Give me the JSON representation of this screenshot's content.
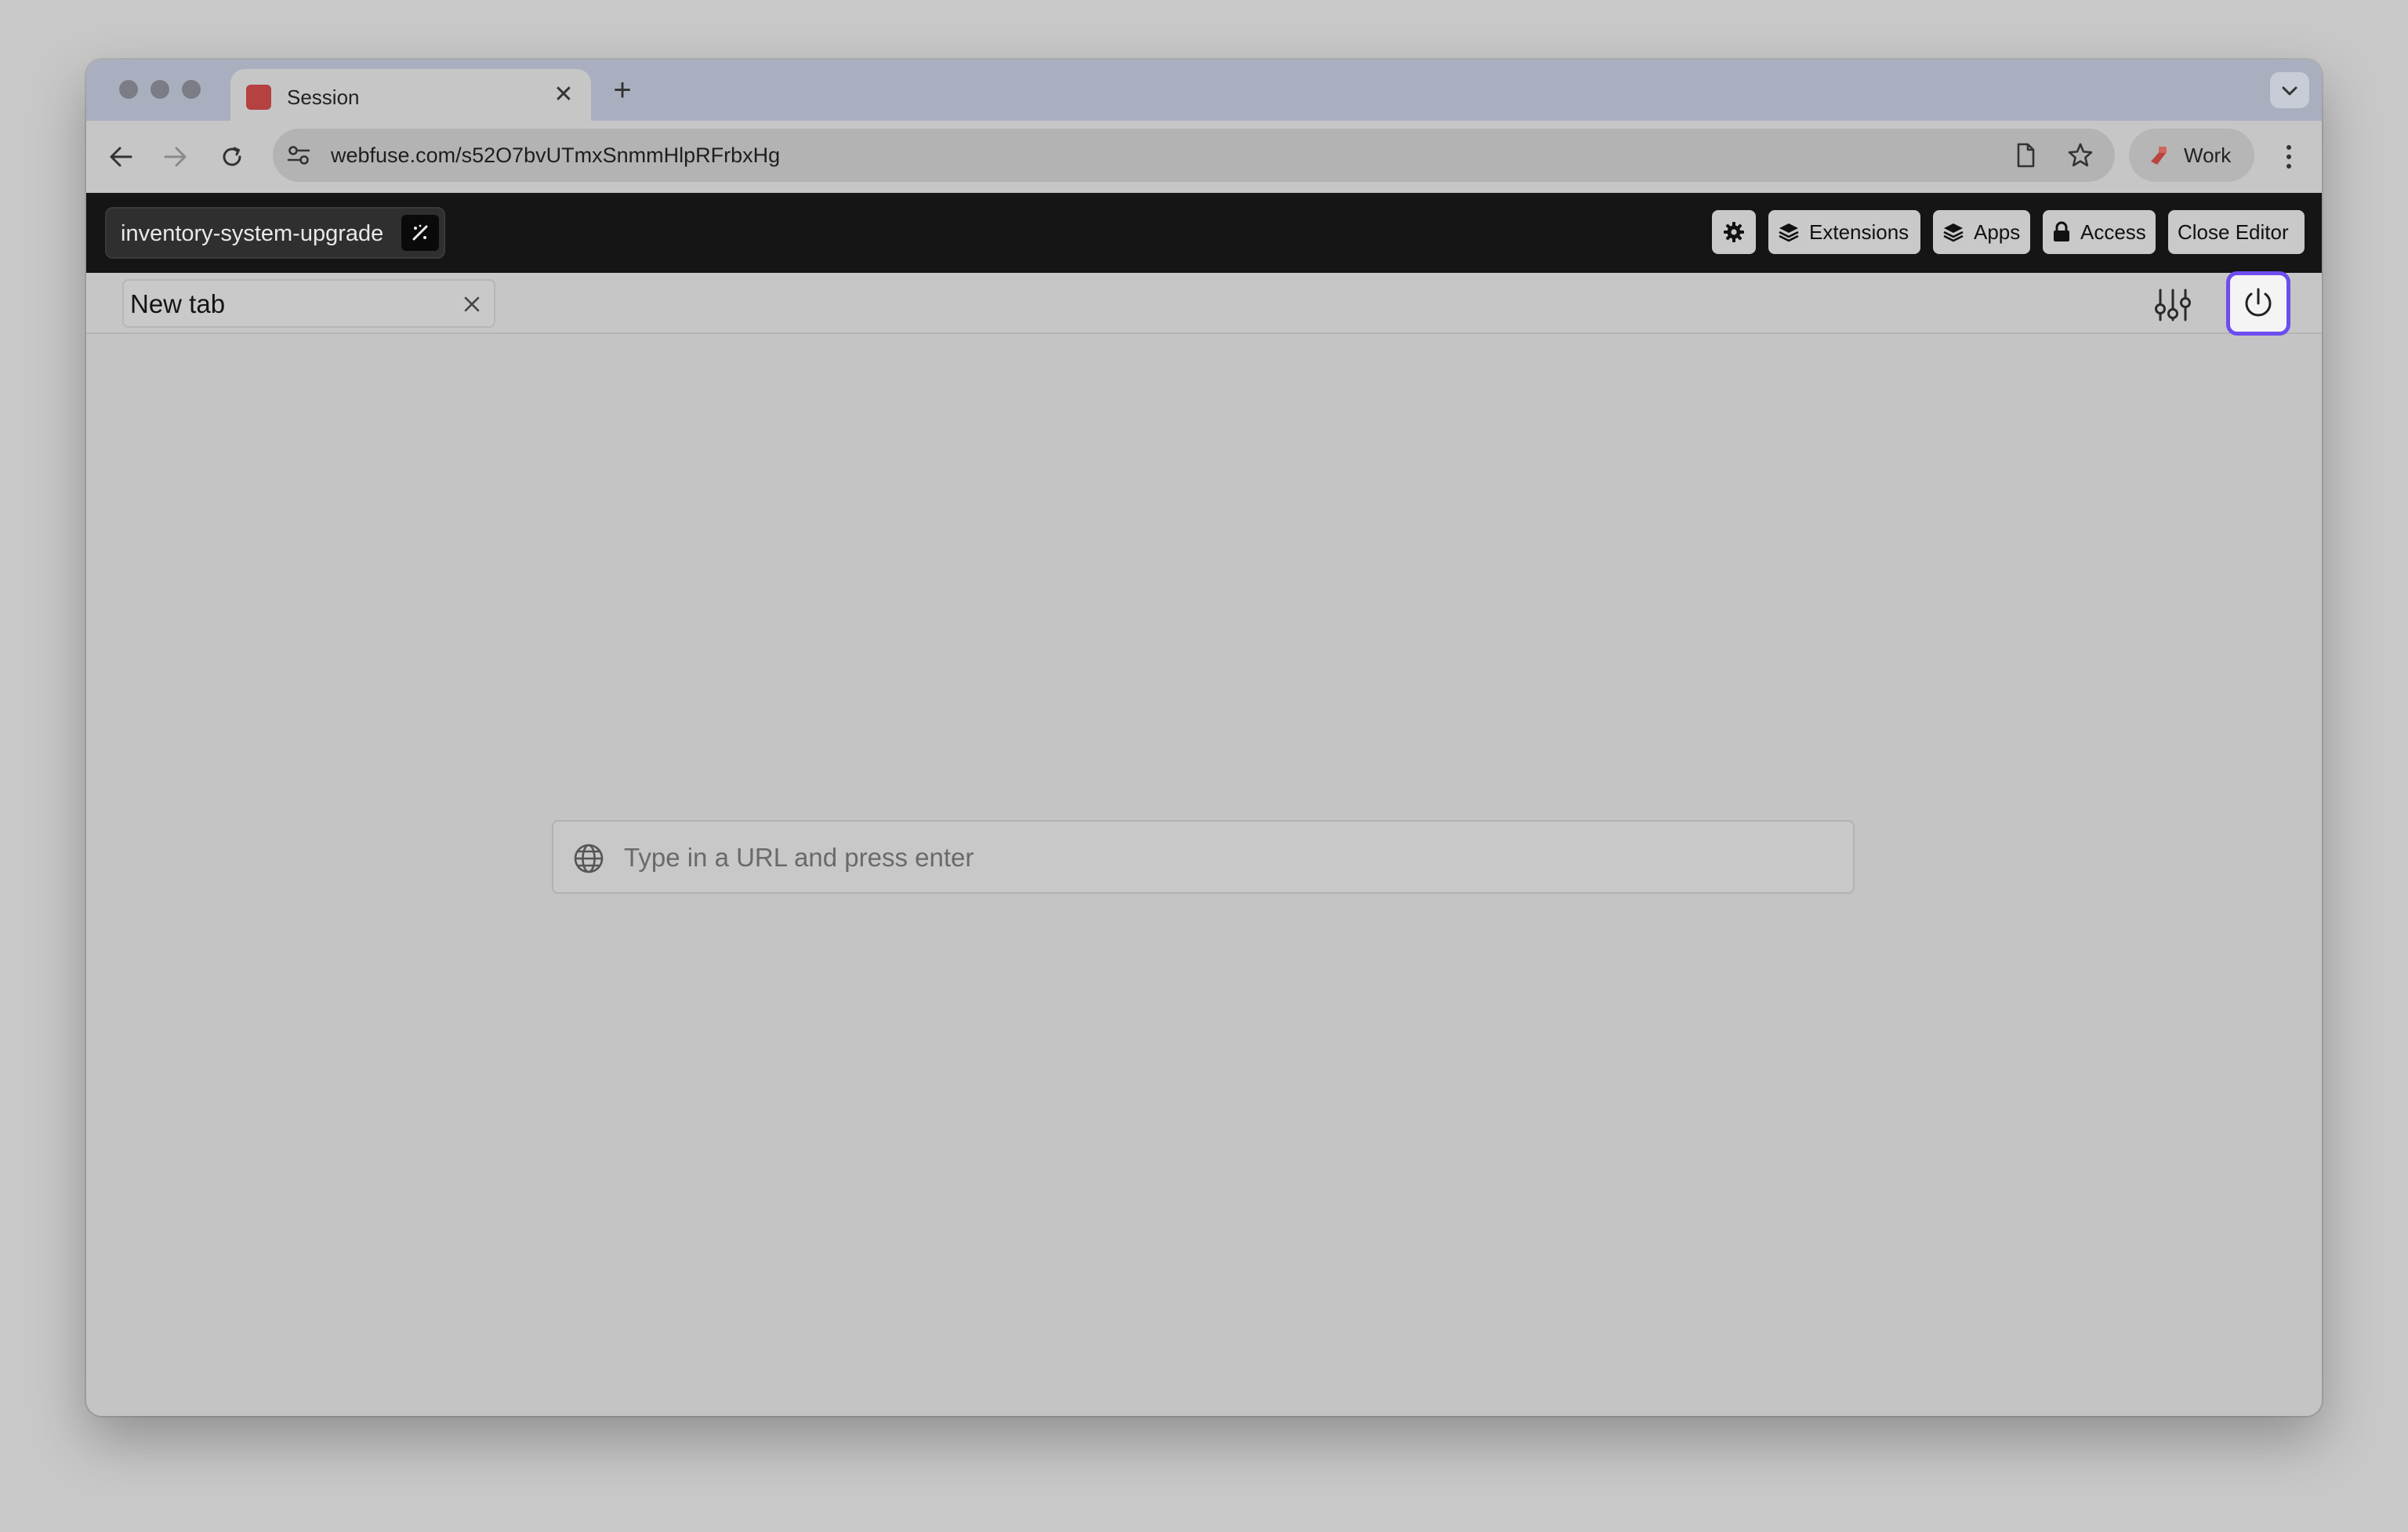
{
  "browser": {
    "tab": {
      "title": "Session",
      "close_glyph": "✕"
    },
    "new_tab_glyph": "+",
    "tab_menu_glyph": "⌄",
    "address": {
      "url": "webfuse.com/s52O7bvUTmxSnmmHlpRFrbxHg"
    },
    "profile": {
      "label": "Work"
    }
  },
  "editor": {
    "project_name": "inventory-system-upgrade",
    "buttons": {
      "extensions": "Extensions",
      "apps": "Apps",
      "access": "Access",
      "close_editor": "Close Editor"
    }
  },
  "session": {
    "tab_title": "New tab",
    "url_input": {
      "placeholder": "Type in a URL and press enter",
      "value": ""
    }
  },
  "icons": {
    "favicon": "session-favicon-icon",
    "back": "arrow-left-icon",
    "forward": "arrow-right-icon",
    "reload": "reload-icon",
    "site_settings": "tune-icon",
    "reader": "document-icon",
    "bookmark": "star-icon",
    "more": "kebab-menu-icon",
    "project": "magic-wand-icon",
    "settings": "gear-icon",
    "extensions": "layers-icon",
    "apps": "layers-icon",
    "access": "lock-icon",
    "sliders": "sliders-icon",
    "power": "power-icon",
    "globe": "globe-icon"
  },
  "colors": {
    "accent_focus": "#6d4cf0",
    "editor_bar": "#151515",
    "favicon": "#b54141"
  }
}
